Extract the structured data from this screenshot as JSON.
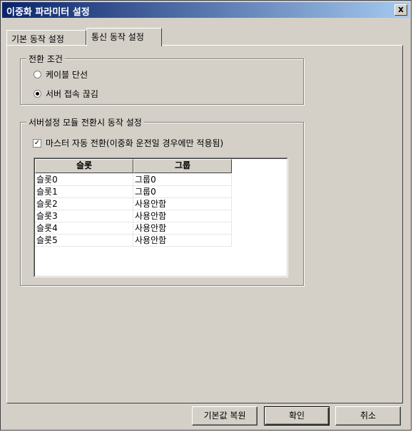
{
  "window": {
    "title": "이중화 파라미터 설정",
    "close_label": "x"
  },
  "tabs": [
    {
      "label": "기본 동작 설정"
    },
    {
      "label": "통신 동작 설정"
    }
  ],
  "switch_condition": {
    "label": "전환 조건",
    "options": [
      {
        "label": "케이블 단선",
        "selected": false
      },
      {
        "label": "서버 접속 끊김",
        "selected": true
      }
    ]
  },
  "module_switch": {
    "label": "서버설정 모듈 전환시 동작 설정",
    "master_auto_switch": {
      "label": "마스터 자동 전환(이중화 운전일 경우에만 적용됨)",
      "checked": true,
      "check_mark": "✓"
    },
    "columns": [
      "슬롯",
      "그룹"
    ],
    "rows": [
      [
        "슬롯0",
        "그룹0"
      ],
      [
        "슬롯1",
        "그룹0"
      ],
      [
        "슬롯2",
        "사용안함"
      ],
      [
        "슬롯3",
        "사용안함"
      ],
      [
        "슬롯4",
        "사용안함"
      ],
      [
        "슬롯5",
        "사용안함"
      ]
    ]
  },
  "buttons": {
    "restore_defaults": "기본값 복원",
    "ok": "확인",
    "cancel": "취소"
  },
  "colors": {
    "titlebar_start": "#0a246a",
    "titlebar_end": "#a6caf0",
    "face": "#d4d0c8"
  }
}
